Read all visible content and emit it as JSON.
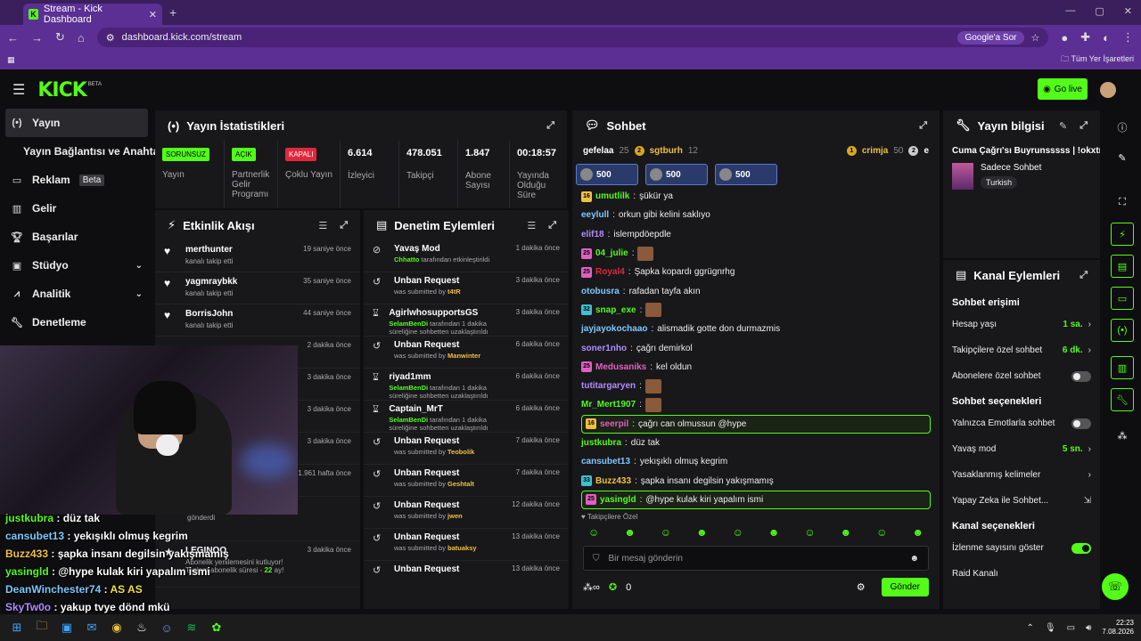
{
  "browser": {
    "tab_title": "Stream - Kick Dashboard",
    "tab_close": "✕",
    "new_tab": "+",
    "url": "dashboard.kick.com/stream",
    "google_search": "Google'a Sor",
    "bookmarks_label": "Tüm Yer İşaretleri"
  },
  "header": {
    "logo": "KICK",
    "beta": "BETA",
    "go_live": "Go live"
  },
  "sidebar": {
    "items": [
      {
        "label": "Yayın",
        "icon": "broadcast-icon"
      },
      {
        "label": "Yayın Bağlantısı ve Anahtarı",
        "icon": ""
      },
      {
        "label": "Reklam",
        "icon": "ad-icon",
        "badge": "Beta"
      },
      {
        "label": "Gelir",
        "icon": "revenue-icon"
      },
      {
        "label": "Başarılar",
        "icon": "trophy-icon"
      },
      {
        "label": "Stüdyo",
        "icon": "studio-icon"
      },
      {
        "label": "Analitik",
        "icon": "analytics-icon"
      },
      {
        "label": "Denetleme",
        "icon": "wrench-icon"
      }
    ]
  },
  "stats": {
    "title": "Yayın İstatistikleri",
    "items": [
      {
        "pill": "SORUNSUZ",
        "label": "Yayın",
        "color": "#53fc18"
      },
      {
        "pill": "AÇIK",
        "label": "Partnerlik Gelir Programı",
        "color": "#53fc18"
      },
      {
        "pill": "KAPALI",
        "label": "Çoklu Yayın",
        "color": "#e0283c"
      },
      {
        "value": "6.614",
        "label": "İzleyici"
      },
      {
        "value": "478.051",
        "label": "Takipçi"
      },
      {
        "value": "1.847",
        "label": "Abone Sayısı"
      },
      {
        "value": "00:18:57",
        "label": "Yayında Olduğu Süre"
      }
    ]
  },
  "activity": {
    "title": "Etkinlik Akışı",
    "rows": [
      {
        "name": "merthunter",
        "sub": "kanalı takip etti",
        "time": "19 saniye önce"
      },
      {
        "name": "yagmraybkk",
        "sub": "kanalı takip etti",
        "time": "35 saniye önce"
      },
      {
        "name": "BorrisJohn",
        "sub": "kanalı takip etti",
        "time": "44 saniye önce"
      },
      {
        "name": "",
        "sub": "",
        "time": "2 dakika önce"
      },
      {
        "name": "",
        "sub": "",
        "time": "3 dakika önce"
      },
      {
        "name": "",
        "sub": "",
        "time": "3 dakika önce"
      },
      {
        "name": "",
        "sub": "",
        "time": "3 dakika önce"
      },
      {
        "name": "",
        "sub": "",
        "time": "1.961 hafta önce"
      }
    ],
    "gift_value": "500",
    "gift_sub": "gönderdi",
    "last_name": "LEGINOO",
    "last_time": "3 dakika önce",
    "last_sub_a": "Abonelik yenilemesini kutluyor! Toplam abonelik süresi - ",
    "last_sub_b": "22",
    "last_sub_c": " ay!"
  },
  "moderation": {
    "title": "Denetim Eylemleri",
    "rows": [
      {
        "name": "Yavaş Mod",
        "actor": "Chhatto",
        "desc": " tarafından etkinleştirildi",
        "time": "1 dakika önce"
      },
      {
        "name": "Unban Request",
        "pre": "was submitted by ",
        "actor": "t4tR",
        "time": "3 dakika önce"
      },
      {
        "name": "AgirlwhosupportsGS",
        "actor": "SelamBenDi",
        "desc": " tarafından 1 dakika süreliğine sohbetten uzaklaştırıldı",
        "time": "3 dakika önce"
      },
      {
        "name": "Unban Request",
        "pre": "was submitted by ",
        "actor": "Manwinter",
        "time": "6 dakika önce"
      },
      {
        "name": "riyad1mm",
        "actor": "SelamBenDi",
        "desc": " tarafından 1 dakika süreliğine sohbetten uzaklaştırıldı",
        "time": "6 dakika önce"
      },
      {
        "name": "Captain_MrT",
        "actor": "SelamBenDi",
        "desc": " tarafından 1 dakika süreliğine sohbetten uzaklaştırıldı",
        "time": "6 dakika önce"
      },
      {
        "name": "Unban Request",
        "pre": "was submitted by ",
        "actor": "Teobolik",
        "time": "7 dakika önce"
      },
      {
        "name": "Unban Request",
        "pre": "was submitted by ",
        "actor": "Geshtalt",
        "time": "7 dakika önce"
      },
      {
        "name": "Unban Request",
        "pre": "was submitted by ",
        "actor": "jwen",
        "time": "12 dakika önce"
      },
      {
        "name": "Unban Request",
        "pre": "was submitted by ",
        "actor": "batuaksy",
        "time": "13 dakika önce"
      },
      {
        "name": "Unban Request",
        "pre": "",
        "actor": "",
        "time": "13 dakika önce"
      }
    ]
  },
  "overlay_chat": [
    {
      "user": "justkubra",
      "sep": " : ",
      "text": "düz tak",
      "color": "#53fc18"
    },
    {
      "user": "cansubet13",
      "sep": " : ",
      "text": "yekışıklı olmuş kegrim",
      "color": "#7ec8ff"
    },
    {
      "user": "Buzz433",
      "sep": " : ",
      "text": "şapka insanı degilsin yakışmamış",
      "color": "#f0c040"
    },
    {
      "user": "yasingld",
      "sep": " : ",
      "text": "@hype kulak kiri yapalım ismi",
      "color": "#53fc18"
    },
    {
      "user": "DeanWinchester74",
      "sep": " : ",
      "text": "AS AS",
      "color": "#7ec8ff"
    },
    {
      "user": "SkyTw0o",
      "sep": " : ",
      "text": "yakup tvye dönd mkü",
      "color": "#b18cff"
    }
  ],
  "chat": {
    "title": "Sohbet",
    "top_users": [
      {
        "name": "gefelaa",
        "count": "25"
      },
      {
        "name": "sgtburh",
        "count": "12"
      },
      {
        "name": "crimja",
        "count": "50"
      }
    ],
    "top_extra": "e",
    "gifts": [
      "500",
      "500",
      "500"
    ],
    "messages": [
      {
        "badge": "16",
        "user": "umutlilk",
        "text": "şükür ya",
        "color": "#53fc18",
        "bcolor": "#f0c040"
      },
      {
        "user": "eeylull",
        "text": "orkun gibi kelini saklıyo",
        "color": "#7ec8ff"
      },
      {
        "user": "elif18",
        "text": "islempdöepdle",
        "color": "#b18cff"
      },
      {
        "badge": "25",
        "user": "04_julie",
        "text": "",
        "color": "#53fc18",
        "emote": true,
        "bcolor": "#e060c0"
      },
      {
        "badge": "25",
        "user": "Royal4",
        "text": "Şapka kopardı ggrügnrhg",
        "color": "#e0283c",
        "bcolor": "#e060c0"
      },
      {
        "user": "otobusra",
        "text": "rafadan tayfa akın",
        "color": "#7ec8ff"
      },
      {
        "badge": "32",
        "user": "snap_exe",
        "text": "",
        "color": "#53fc18",
        "emote": true,
        "bcolor": "#40c0d0"
      },
      {
        "user": "jayjayokochaao",
        "text": "alismadik gotte don durmazmis",
        "color": "#7ec8ff"
      },
      {
        "user": "soner1nho",
        "text": "çağrı demirkol",
        "color": "#b18cff"
      },
      {
        "badge": "25",
        "user": "Medusaniks",
        "text": "kel oldun",
        "color": "#e060c0",
        "bcolor": "#e060c0"
      },
      {
        "user": "tutitargaryen",
        "text": "",
        "color": "#b18cff",
        "emote": true
      },
      {
        "user": "Mr_Mert1907",
        "text": "",
        "color": "#53fc18",
        "emote": true
      },
      {
        "badge": "16",
        "user": "seerpil",
        "text": "çağrı can olmussun @hype",
        "color": "#e060c0",
        "highlight": true,
        "bcolor": "#f0c040"
      },
      {
        "user": "justkubra",
        "text": "düz tak",
        "color": "#53fc18"
      },
      {
        "user": "cansubet13",
        "text": "yekışıklı olmuş kegrim",
        "color": "#7ec8ff"
      },
      {
        "badge": "33",
        "user": "Buzz433",
        "text": "şapka insanı degilsin yakışmamış",
        "color": "#f0c040",
        "bcolor": "#40c0d0"
      },
      {
        "badge": "25",
        "user": "yasingld",
        "text": "@hype kulak kiri yapalım ismi",
        "color": "#53fc18",
        "highlight": true,
        "bcolor": "#e060c0"
      }
    ],
    "sub_only_label": "Takipçilere Özel",
    "input_placeholder": "Bir mesaj gönderin",
    "points": "0",
    "send": "Gönder"
  },
  "stream_info": {
    "title": "Yayın bilgisi",
    "stream_title": "Cuma Çağrı'sı Buyrunsssss | !okxtr",
    "category": "Sadece Sohbet",
    "tag": "Turkish"
  },
  "channel_actions": {
    "title": "Kanal Eylemleri",
    "chat_access": "Sohbet erişimi",
    "account_age": {
      "label": "Hesap yaşı",
      "value": "1 sa."
    },
    "followers_only": {
      "label": "Takipçilere özel sohbet",
      "value": "6 dk."
    },
    "subs_only": {
      "label": "Abonelere özel sohbet"
    },
    "chat_options": "Sohbet seçenekleri",
    "emotes_only": {
      "label": "Yalnızca Emotlarla sohbet"
    },
    "slow_mode": {
      "label": "Yavaş mod",
      "value": "5 sn."
    },
    "banned_words": {
      "label": "Yasaklanmış kelimeler"
    },
    "ai_chat": {
      "label": "Yapay Zeka ile Sohbet..."
    },
    "channel_options": "Kanal seçenekleri",
    "show_views": {
      "label": "İzlenme sayısını göster"
    },
    "raid": {
      "label": "Raid Kanalı"
    }
  },
  "taskbar": {
    "time": "22:23",
    "date": "7.08.2026"
  }
}
